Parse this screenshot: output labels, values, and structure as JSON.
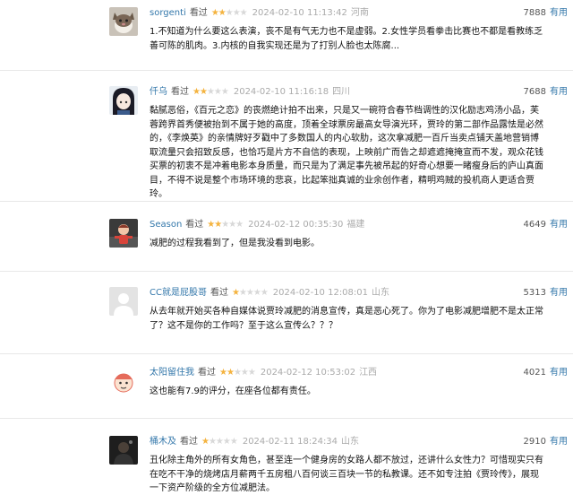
{
  "watched_label": "看过",
  "useful_label": "有用",
  "reviews": [
    {
      "user": "sorgenti",
      "rating": 2,
      "time": "2024-02-10 11:13:42",
      "location": "河南",
      "votes": "7888",
      "text": "1.不知道为什么要这么表演，丧不是有气无力也不是虚弱。2.女性学员看拳击比赛也不都是看教练乏善可陈的肌肉。3.内核的自我实现还是为了打别人脸也太陈腐..."
    },
    {
      "user": "仟乌",
      "rating": 2,
      "time": "2024-02-10 11:16:18",
      "location": "四川",
      "votes": "7688",
      "text": "黏腻恶俗，《百元之恋》的丧燃绝计拍不出来，只是又一碗符合春节档调性的汉化励志鸡汤小品，芙蓉跨界首秀便被抬到不属于她的高度，顶着全球票房最高女导演光环，贾玲的第二部作品露怯是必然的，《李焕英》的亲情牌好歹戳中了多数国人的内心软肋，这次拿减肥一百斤当卖点铺天盖地营销博取流量只会招致反感，也恰巧是片方不自信的表现，上映前广而告之却遮遮掩掩宣而不发，观众花钱买票的初衷不是冲着电影本身质量，而只是为了满足事先被吊起的好奇心想要一睹瘦身后的庐山真面目，不得不说是整个市场环境的悲哀，比起笨拙真诚的业余创作者，精明鸡贼的投机商人更适合贾玲。"
    },
    {
      "user": "Season",
      "rating": 2,
      "time": "2024-02-12 00:35:30",
      "location": "福建",
      "votes": "4649",
      "text": "减肥的过程我看到了，但是我没看到电影。"
    },
    {
      "user": "CC就是屁股哥",
      "rating": 1,
      "time": "2024-02-10 12:08:01",
      "location": "山东",
      "votes": "5313",
      "text": "从去年就开始买各种自媒体说贾玲减肥的消息宣传，真是恶心死了。你为了电影减肥增肥不是太正常了？这不是你的工作吗？至于这么宣传么？？？"
    },
    {
      "user": "太阳留住我",
      "rating": 2,
      "time": "2024-02-12 10:53:02",
      "location": "江西",
      "votes": "4021",
      "text": "这也能有7.9的评分，在座各位都有责任。"
    },
    {
      "user": "桶木及",
      "rating": 1,
      "time": "2024-02-11 18:24:34",
      "location": "山东",
      "votes": "2910",
      "text": "丑化除主角外的所有女角色，甚至连一个健身房的女路人都不放过，还讲什么女性力？可惜现实只有在吃不干净的烧烤店月薪两千五房租八百何谈三百块一节的私教课。还不如专注拍《贾玲传》，展现一下资产阶级的全方位减肥法。"
    }
  ],
  "colors": {
    "link": "#3377aa",
    "star_on": "#f4b33f",
    "star_off": "#d8d8d8",
    "meta_gray": "#aaaaaa"
  },
  "avatars": [
    "cat-avatar-icon",
    "anime-girl-avatar-icon",
    "cartoon-doll-avatar-icon",
    "default-user-avatar-icon",
    "cartoon-face-avatar-icon",
    "dark-photo-avatar-icon"
  ]
}
